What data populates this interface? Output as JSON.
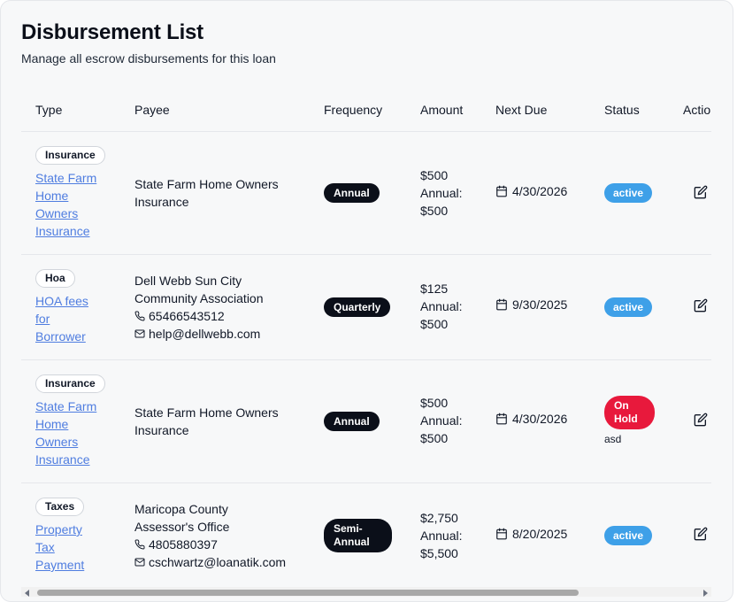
{
  "header": {
    "title": "Disbursement List",
    "subtitle": "Manage all escrow disbursements for this loan"
  },
  "columns": [
    "Type",
    "Payee",
    "Frequency",
    "Amount",
    "Next Due",
    "Status",
    "Actio"
  ],
  "rows": [
    {
      "type_badge": "Insurance",
      "type_link_lines": [
        "State Farm",
        "Home",
        "Owners",
        "Insurance"
      ],
      "payee_lines": [
        "State Farm Home Owners",
        "Insurance"
      ],
      "phone": "",
      "email": "",
      "frequency_lines": [
        "Annual"
      ],
      "amount": "$500",
      "annual_label": "Annual:",
      "annual_amount": "$500",
      "next_due": "4/30/2026",
      "status_lines": [
        "active"
      ],
      "status_note": ""
    },
    {
      "type_badge": "Hoa",
      "type_link_lines": [
        "HOA fees",
        "for",
        "Borrower"
      ],
      "payee_lines": [
        "Dell Webb Sun City",
        "Community Association"
      ],
      "phone": "65466543512",
      "email": "help@dellwebb.com",
      "frequency_lines": [
        "Quarterly"
      ],
      "amount": "$125",
      "annual_label": "Annual:",
      "annual_amount": "$500",
      "next_due": "9/30/2025",
      "status_lines": [
        "active"
      ],
      "status_note": ""
    },
    {
      "type_badge": "Insurance",
      "type_link_lines": [
        "State Farm",
        "Home",
        "Owners",
        "Insurance"
      ],
      "payee_lines": [
        "State Farm Home Owners",
        "Insurance"
      ],
      "phone": "",
      "email": "",
      "frequency_lines": [
        "Annual"
      ],
      "amount": "$500",
      "annual_label": "Annual:",
      "annual_amount": "$500",
      "next_due": "4/30/2026",
      "status_lines": [
        "On",
        "Hold"
      ],
      "status_note": "asd"
    },
    {
      "type_badge": "Taxes",
      "type_link_lines": [
        "Property",
        "Tax",
        "Payment"
      ],
      "payee_lines": [
        "Maricopa County",
        "Assessor's Office"
      ],
      "phone": "4805880397",
      "email": "cschwartz@loanatik.com",
      "frequency_lines": [
        "Semi-",
        "Annual"
      ],
      "amount": "$2,750",
      "annual_label": "Annual:",
      "annual_amount": "$5,500",
      "next_due": "8/20/2025",
      "status_lines": [
        "active"
      ],
      "status_note": ""
    }
  ],
  "icons": {
    "calendar": "calendar-icon",
    "edit": "edit-icon",
    "phone": "phone-icon",
    "mail": "mail-icon"
  },
  "colors": {
    "link": "#4f7de0",
    "frequency_badge": "#0b0f19",
    "status_active": "#3ea0e8",
    "status_on_hold": "#e8193c"
  }
}
